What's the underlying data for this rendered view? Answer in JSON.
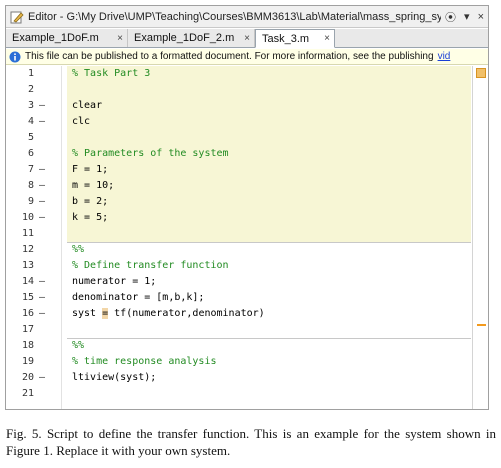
{
  "window": {
    "title": "Editor - G:\\My Drive\\UMP\\Teaching\\Courses\\BMM3613\\Lab\\Material\\mass_spring_sys...",
    "menu_button": "⦿",
    "options_button": "▾",
    "close_button": "×"
  },
  "tabs": [
    {
      "label": "Example_1DoF.m",
      "close": "×"
    },
    {
      "label": "Example_1DoF_2.m",
      "close": "×"
    },
    {
      "label": "Task_3.m",
      "close": "×"
    }
  ],
  "infobar": {
    "text": "This file can be published to a formatted document. For more information, see the publishing",
    "link": "vid"
  },
  "code_lines": [
    {
      "n": "1",
      "dash": "",
      "text": "% Task Part 3",
      "kind": "comment"
    },
    {
      "n": "2",
      "dash": "",
      "text": "",
      "kind": "code"
    },
    {
      "n": "3",
      "dash": "—",
      "text": "clear",
      "kind": "code"
    },
    {
      "n": "4",
      "dash": "—",
      "text": "clc",
      "kind": "code"
    },
    {
      "n": "5",
      "dash": "",
      "text": "",
      "kind": "code"
    },
    {
      "n": "6",
      "dash": "",
      "text": "% Parameters of the system",
      "kind": "comment"
    },
    {
      "n": "7",
      "dash": "—",
      "text": "F = 1;",
      "kind": "code"
    },
    {
      "n": "8",
      "dash": "—",
      "text": "m = 10;",
      "kind": "code"
    },
    {
      "n": "9",
      "dash": "—",
      "text": "b = 2;",
      "kind": "code"
    },
    {
      "n": "10",
      "dash": "—",
      "text": "k = 5;",
      "kind": "code"
    },
    {
      "n": "11",
      "dash": "",
      "text": "",
      "kind": "code"
    },
    {
      "n": "12",
      "dash": "",
      "text": "%%",
      "kind": "comment"
    },
    {
      "n": "13",
      "dash": "",
      "text": "% Define transfer function",
      "kind": "comment"
    },
    {
      "n": "14",
      "dash": "—",
      "text": "numerator = 1;",
      "kind": "code"
    },
    {
      "n": "15",
      "dash": "—",
      "text": "denominator = [m,b,k];",
      "kind": "code"
    },
    {
      "n": "16",
      "dash": "—",
      "text": "syst = tf(numerator,denominator)",
      "kind": "code"
    },
    {
      "n": "17",
      "dash": "",
      "text": "",
      "kind": "code"
    },
    {
      "n": "18",
      "dash": "",
      "text": "%%",
      "kind": "comment"
    },
    {
      "n": "19",
      "dash": "",
      "text": "% time response analysis",
      "kind": "comment"
    },
    {
      "n": "20",
      "dash": "—",
      "text": "ltiview(syst);",
      "kind": "code"
    },
    {
      "n": "21",
      "dash": "",
      "text": "",
      "kind": "code"
    }
  ],
  "warning_line": "16",
  "colors": {
    "comment": "#228b22",
    "cell_highlight": "#f7f6d5",
    "warning_marker": "#f39a1e",
    "info_bar": "#ffffe6"
  },
  "caption": {
    "text": "Fig. 5.   Script to define the transfer function. This is an example for the system shown in Figure 1. Replace it with your own system."
  }
}
